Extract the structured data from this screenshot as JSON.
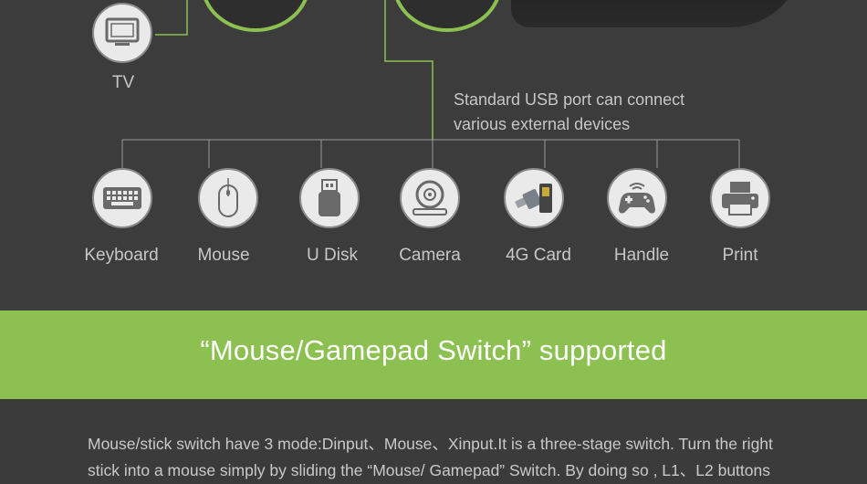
{
  "tv": {
    "label": "TV",
    "icon": "tv-icon"
  },
  "usb_note": {
    "line1": "Standard USB port can connect",
    "line2": "various external devices"
  },
  "devices": [
    {
      "label": "Keyboard",
      "icon": "keyboard-icon"
    },
    {
      "label": "Mouse",
      "icon": "mouse-icon"
    },
    {
      "label": "U Disk",
      "icon": "usb-disk-icon"
    },
    {
      "label": "Camera",
      "icon": "camera-icon"
    },
    {
      "label": "4G Card",
      "icon": "sim-card-icon"
    },
    {
      "label": "Handle",
      "icon": "gamepad-icon"
    },
    {
      "label": "Print",
      "icon": "printer-icon"
    }
  ],
  "banner": {
    "title": "“Mouse/Gamepad Switch” supported"
  },
  "description": {
    "line1": "Mouse/stick switch have 3 mode:Dinput、Mouse、Xinput.It is a three-stage switch. Turn the right",
    "line2": "stick into a mouse simply by sliding the “Mouse/ Gamepad” Switch. By doing so , L1、L2 buttons"
  },
  "colors": {
    "accent": "#8cc151",
    "background": "#3c3c3c",
    "icon_bg": "#eaeaea"
  }
}
